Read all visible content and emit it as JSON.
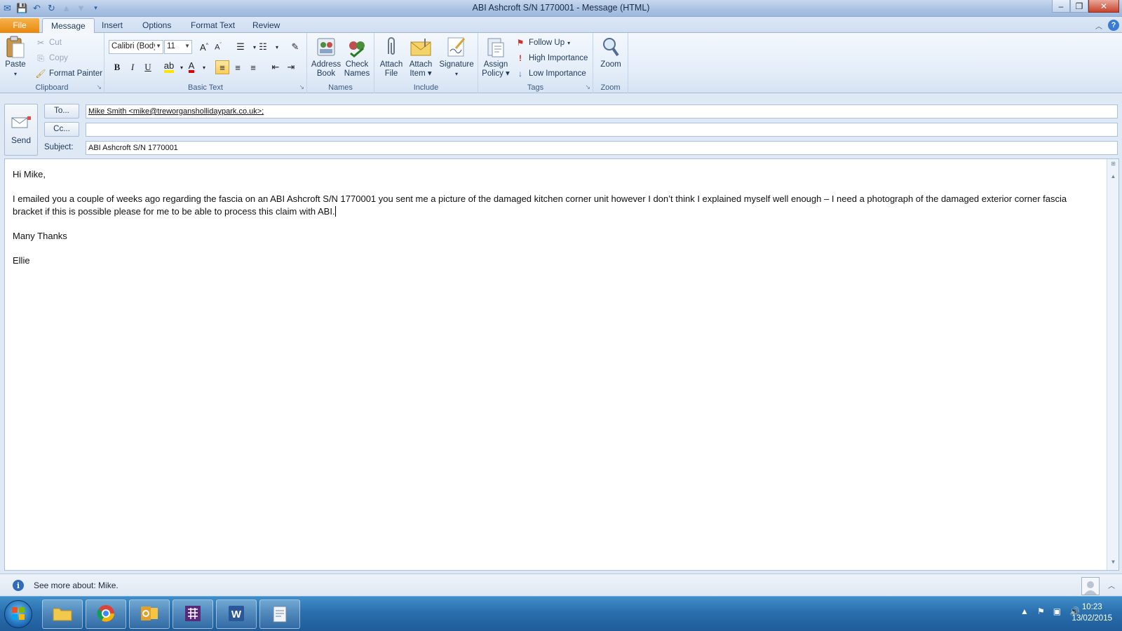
{
  "window": {
    "title": "ABI Ashcroft S/N 1770001  -  Message (HTML)"
  },
  "tabs": {
    "file": "File",
    "message": "Message",
    "insert": "Insert",
    "options": "Options",
    "format_text": "Format Text",
    "review": "Review"
  },
  "ribbon": {
    "clipboard": {
      "label": "Clipboard",
      "paste": "Paste",
      "cut": "Cut",
      "copy": "Copy",
      "format_painter": "Format Painter"
    },
    "basic_text": {
      "label": "Basic Text",
      "font_name": "Calibri (Body)",
      "font_size": "11"
    },
    "names": {
      "label": "Names",
      "address_book_1": "Address",
      "address_book_2": "Book",
      "check_names_1": "Check",
      "check_names_2": "Names"
    },
    "include": {
      "label": "Include",
      "attach_file_1": "Attach",
      "attach_file_2": "File",
      "attach_item_1": "Attach",
      "attach_item_2": "Item",
      "signature": "Signature"
    },
    "tags": {
      "label": "Tags",
      "assign_policy_1": "Assign",
      "assign_policy_2": "Policy",
      "follow_up": "Follow Up",
      "high_importance": "High Importance",
      "low_importance": "Low Importance"
    },
    "zoom": {
      "label": "Zoom",
      "zoom": "Zoom"
    }
  },
  "compose": {
    "send": "Send",
    "to_button": "To...",
    "cc_button": "Cc...",
    "subject_label": "Subject:",
    "to_value": "Mike Smith <mike@treworganshollidaypark.co.uk>;",
    "cc_value": "",
    "subject_value": "ABI Ashcroft S/N 1770001"
  },
  "body": {
    "greeting": "Hi Mike,",
    "paragraph": "I emailed you a couple of weeks ago regarding the fascia on an ABI Ashcroft S/N 1770001 you sent me a picture of the damaged kitchen corner unit however I don’t think I explained myself well enough – I need a photograph of the damaged exterior corner fascia bracket if this is possible please for me to be able to process this claim with ABI.",
    "closing": "Many Thanks",
    "signature": "Ellie"
  },
  "people_pane": {
    "text": "See more about: Mike."
  },
  "taskbar": {
    "time": "10:23",
    "date": "13/02/2015"
  },
  "colors": {
    "accent": "#e8870f",
    "ribbon_bg": "#e2ecf8",
    "taskbar": "#2a6fae"
  }
}
